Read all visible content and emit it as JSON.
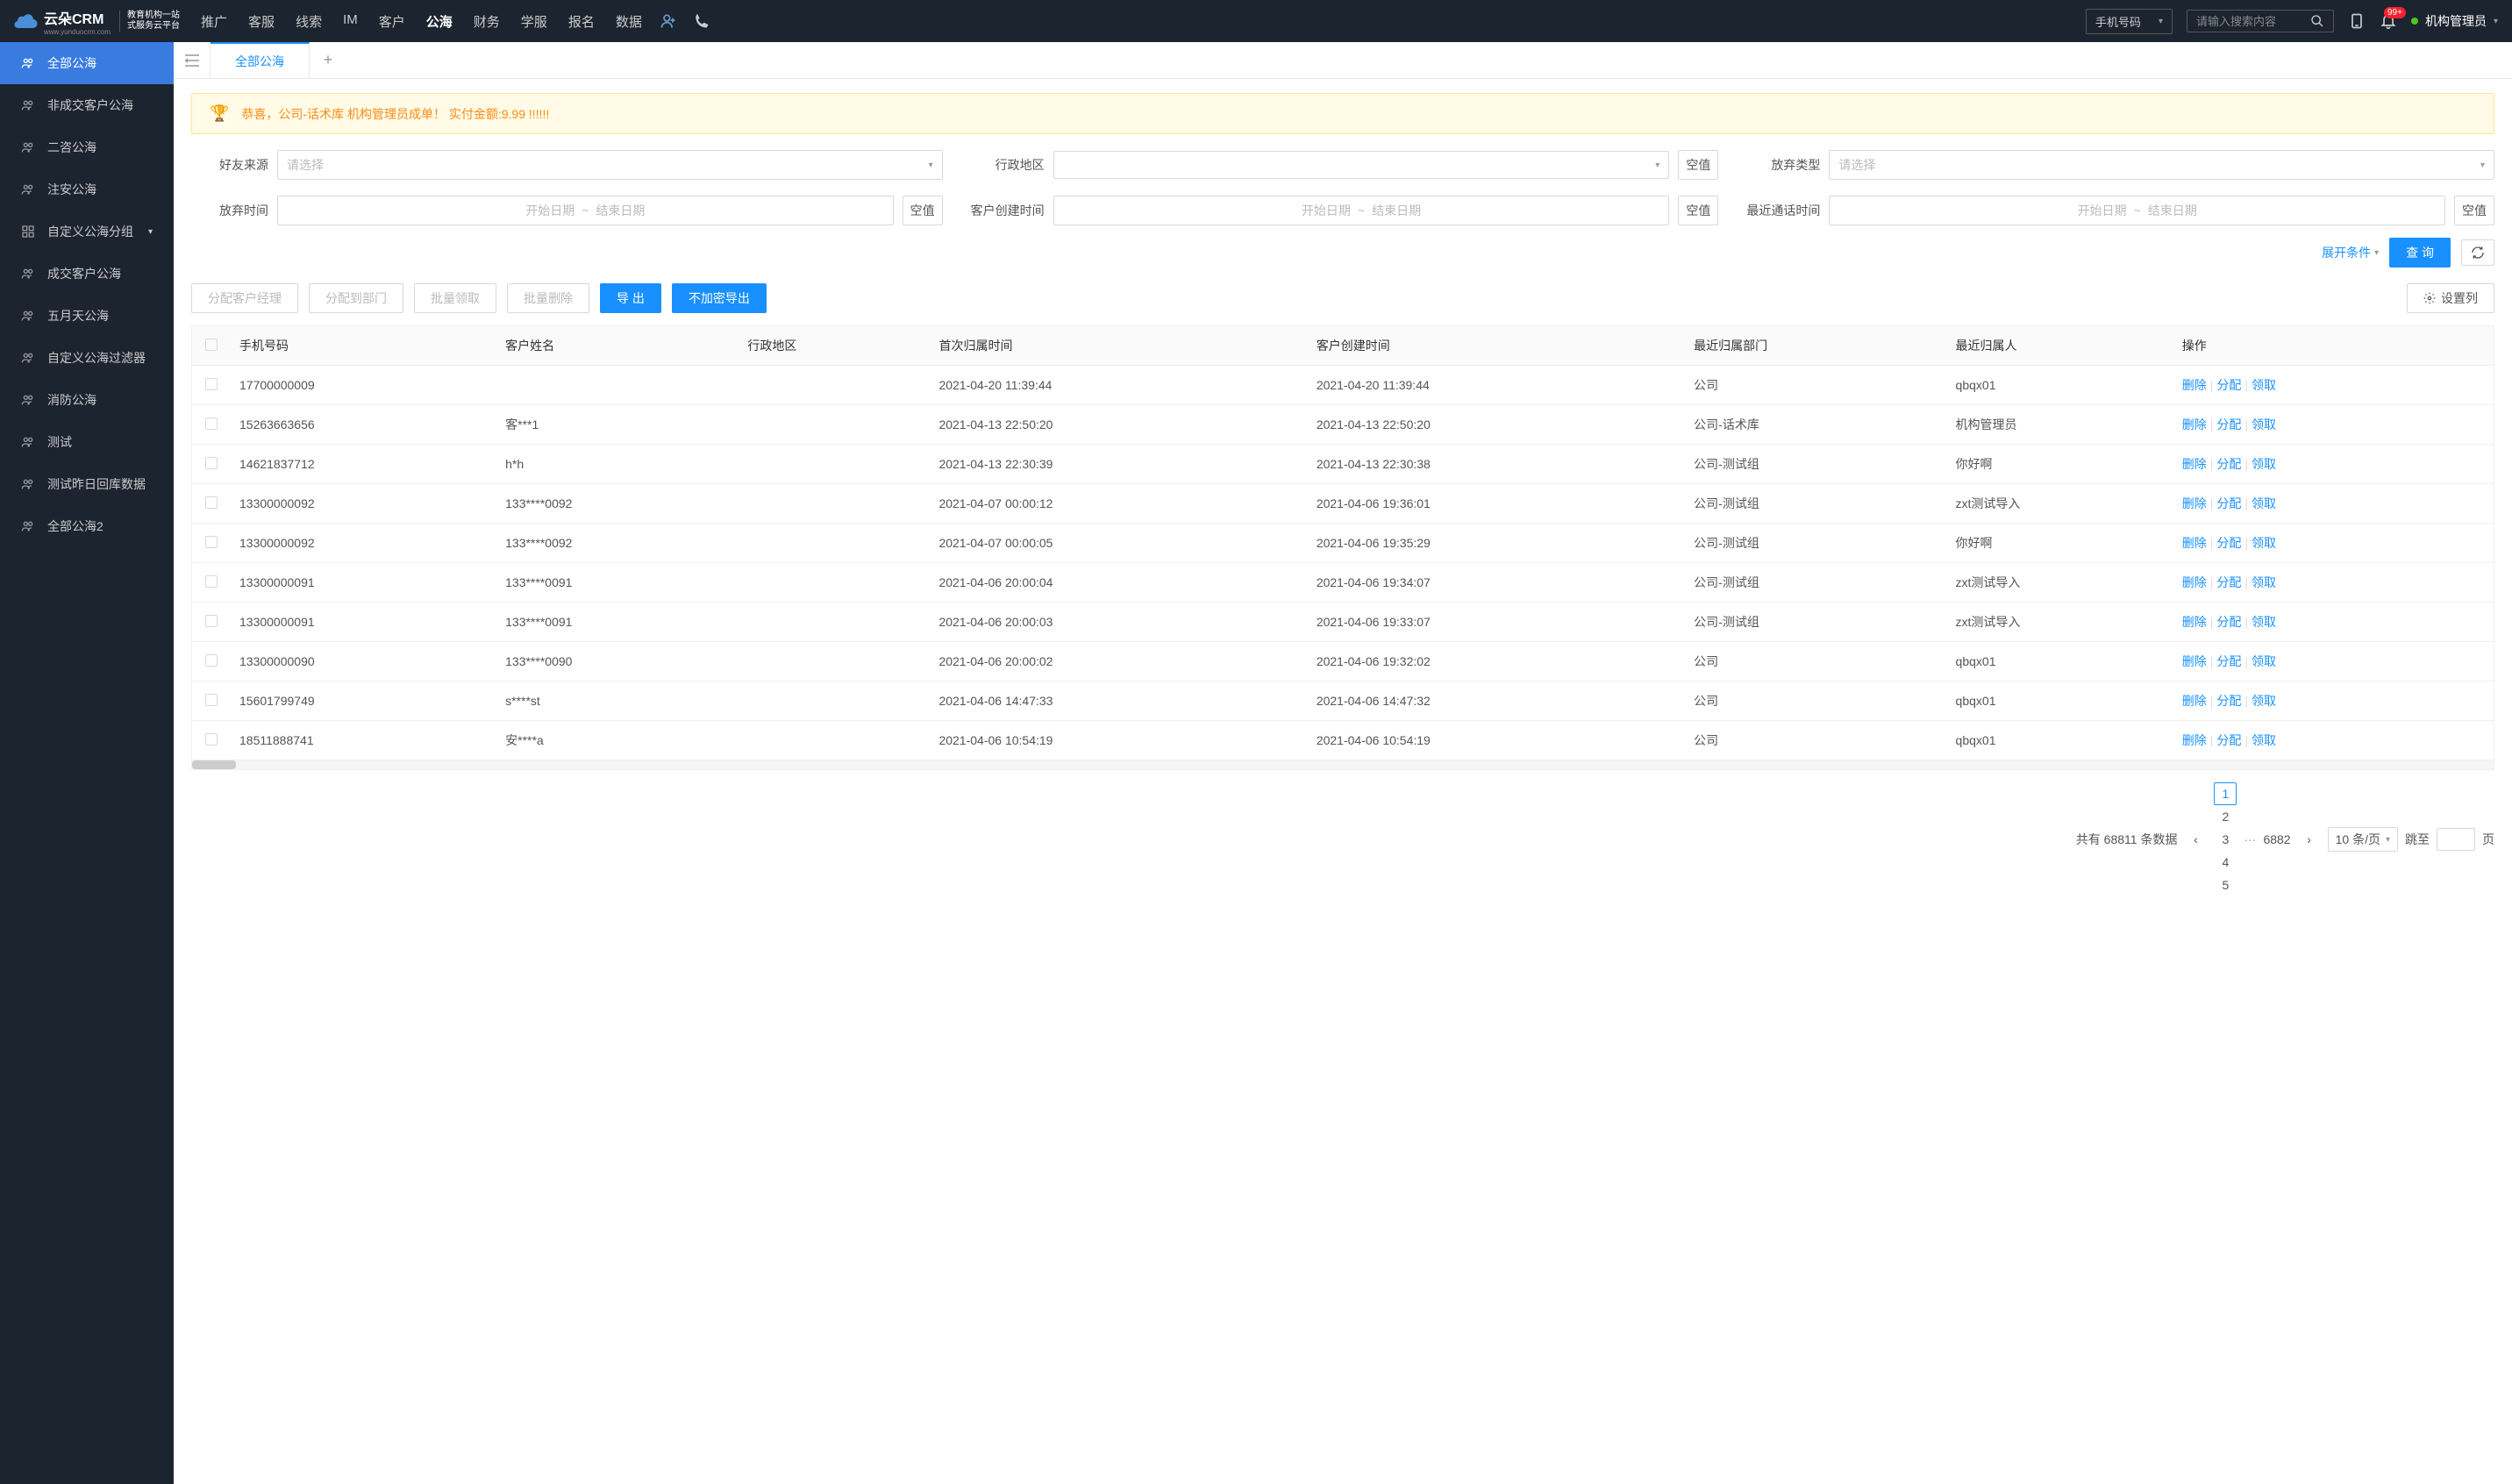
{
  "header": {
    "logo_main": "云朵CRM",
    "logo_url": "www.yunduocrm.com",
    "logo_sub1": "教育机构一站",
    "logo_sub2": "式服务云平台",
    "nav": [
      "推广",
      "客服",
      "线索",
      "IM",
      "客户",
      "公海",
      "财务",
      "学服",
      "报名",
      "数据"
    ],
    "nav_active": 5,
    "search_type": "手机号码",
    "search_placeholder": "请输入搜索内容",
    "badge": "99+",
    "user": "机构管理员"
  },
  "sidebar": {
    "items": [
      {
        "label": "全部公海",
        "icon": "users"
      },
      {
        "label": "非成交客户公海",
        "icon": "users"
      },
      {
        "label": "二咨公海",
        "icon": "users"
      },
      {
        "label": "注安公海",
        "icon": "users"
      },
      {
        "label": "自定义公海分组",
        "icon": "grid",
        "expandable": true
      },
      {
        "label": "成交客户公海",
        "icon": "users"
      },
      {
        "label": "五月天公海",
        "icon": "users"
      },
      {
        "label": "自定义公海过滤器",
        "icon": "users"
      },
      {
        "label": "消防公海",
        "icon": "users"
      },
      {
        "label": "测试",
        "icon": "users"
      },
      {
        "label": "测试昨日回库数据",
        "icon": "users"
      },
      {
        "label": "全部公海2",
        "icon": "users"
      }
    ],
    "active": 0
  },
  "tabs": {
    "active": "全部公海"
  },
  "banner": "恭喜，公司-话术库  机构管理员成单！  实付金额:9.99 !!!!!!",
  "filters": {
    "friend_source": {
      "label": "好友来源",
      "placeholder": "请选择"
    },
    "region": {
      "label": "行政地区",
      "empty_btn": "空值"
    },
    "abandon_type": {
      "label": "放弃类型",
      "placeholder": "请选择"
    },
    "abandon_time": {
      "label": "放弃时间",
      "start": "开始日期",
      "end": "结束日期",
      "empty_btn": "空值"
    },
    "create_time": {
      "label": "客户创建时间",
      "start": "开始日期",
      "end": "结束日期",
      "empty_btn": "空值"
    },
    "last_call_time": {
      "label": "最近通话时间",
      "start": "开始日期",
      "end": "结束日期",
      "empty_btn": "空值"
    },
    "expand": "展开条件",
    "query": "查 询"
  },
  "actions": {
    "assign_manager": "分配客户经理",
    "assign_dept": "分配到部门",
    "batch_claim": "批量领取",
    "batch_delete": "批量删除",
    "export": "导 出",
    "export_plain": "不加密导出",
    "settings": "设置列"
  },
  "table": {
    "headers": [
      "手机号码",
      "客户姓名",
      "行政地区",
      "首次归属时间",
      "客户创建时间",
      "最近归属部门",
      "最近归属人",
      "操作"
    ],
    "ops": {
      "delete": "删除",
      "assign": "分配",
      "claim": "领取"
    },
    "rows": [
      {
        "phone": "17700000009",
        "name": "",
        "region": "",
        "first_time": "2021-04-20 11:39:44",
        "create_time": "2021-04-20 11:39:44",
        "dept": "公司",
        "owner": "qbqx01"
      },
      {
        "phone": "15263663656",
        "name": "客***1",
        "region": "",
        "first_time": "2021-04-13 22:50:20",
        "create_time": "2021-04-13 22:50:20",
        "dept": "公司-话术库",
        "owner": "机构管理员"
      },
      {
        "phone": "14621837712",
        "name": "h*h",
        "region": "",
        "first_time": "2021-04-13 22:30:39",
        "create_time": "2021-04-13 22:30:38",
        "dept": "公司-测试组",
        "owner": "你好啊"
      },
      {
        "phone": "13300000092",
        "name": "133****0092",
        "region": "",
        "first_time": "2021-04-07 00:00:12",
        "create_time": "2021-04-06 19:36:01",
        "dept": "公司-测试组",
        "owner": "zxt测试导入"
      },
      {
        "phone": "13300000092",
        "name": "133****0092",
        "region": "",
        "first_time": "2021-04-07 00:00:05",
        "create_time": "2021-04-06 19:35:29",
        "dept": "公司-测试组",
        "owner": "你好啊"
      },
      {
        "phone": "13300000091",
        "name": "133****0091",
        "region": "",
        "first_time": "2021-04-06 20:00:04",
        "create_time": "2021-04-06 19:34:07",
        "dept": "公司-测试组",
        "owner": "zxt测试导入"
      },
      {
        "phone": "13300000091",
        "name": "133****0091",
        "region": "",
        "first_time": "2021-04-06 20:00:03",
        "create_time": "2021-04-06 19:33:07",
        "dept": "公司-测试组",
        "owner": "zxt测试导入"
      },
      {
        "phone": "13300000090",
        "name": "133****0090",
        "region": "",
        "first_time": "2021-04-06 20:00:02",
        "create_time": "2021-04-06 19:32:02",
        "dept": "公司",
        "owner": "qbqx01"
      },
      {
        "phone": "15601799749",
        "name": "s****st",
        "region": "",
        "first_time": "2021-04-06 14:47:33",
        "create_time": "2021-04-06 14:47:32",
        "dept": "公司",
        "owner": "qbqx01"
      },
      {
        "phone": "18511888741",
        "name": "安****a",
        "region": "",
        "first_time": "2021-04-06 10:54:19",
        "create_time": "2021-04-06 10:54:19",
        "dept": "公司",
        "owner": "qbqx01"
      }
    ]
  },
  "pagination": {
    "total_prefix": "共有",
    "total": "68811",
    "total_suffix": "条数据",
    "pages": [
      "1",
      "2",
      "3",
      "4",
      "5"
    ],
    "last": "6882",
    "per_page": "10 条/页",
    "jump_prefix": "跳至",
    "jump_suffix": "页"
  }
}
